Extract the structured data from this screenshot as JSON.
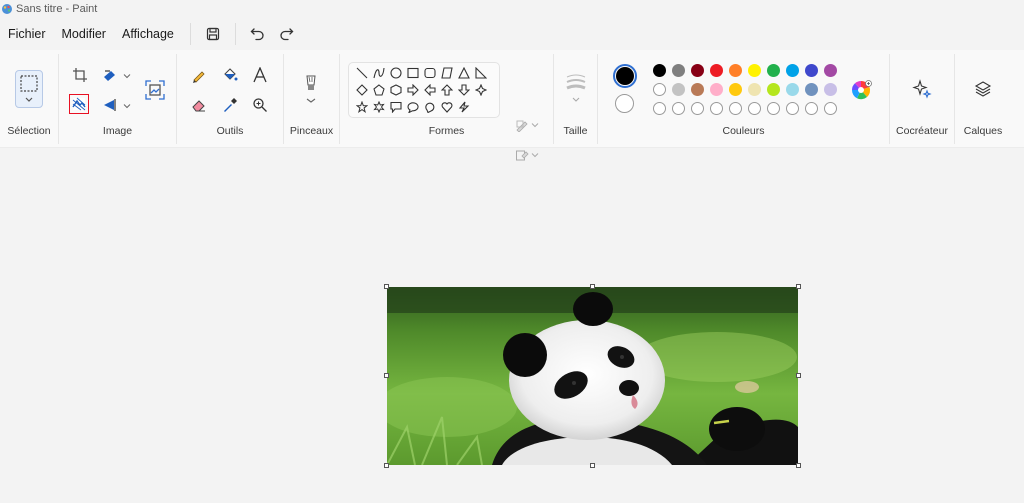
{
  "window": {
    "title": "Sans titre - Paint"
  },
  "menu": {
    "file": "Fichier",
    "edit": "Modifier",
    "view": "Affichage"
  },
  "groups": {
    "selection": "Sélection",
    "image": "Image",
    "tools": "Outils",
    "brushes": "Pinceaux",
    "shapes": "Formes",
    "size": "Taille",
    "colors": "Couleurs",
    "cocreator": "Cocréateur",
    "layers": "Calques"
  },
  "colors": {
    "primary": "#000000",
    "secondary": "#ffffff",
    "row1": [
      "#000000",
      "#7f7f7f",
      "#880015",
      "#ed1c24",
      "#ff7f27",
      "#fff200",
      "#22b14c",
      "#00a2e8",
      "#3f48cc",
      "#a349a4"
    ],
    "row2": [
      "#ffffff",
      "#c3c3c3",
      "#b97a57",
      "#ffaec9",
      "#ffc90e",
      "#efe4b0",
      "#b5e61d",
      "#99d9ea",
      "#7092be",
      "#c8bfe7"
    ],
    "highlight": "#e81123"
  },
  "canvas": {
    "content": "panda-photo"
  }
}
